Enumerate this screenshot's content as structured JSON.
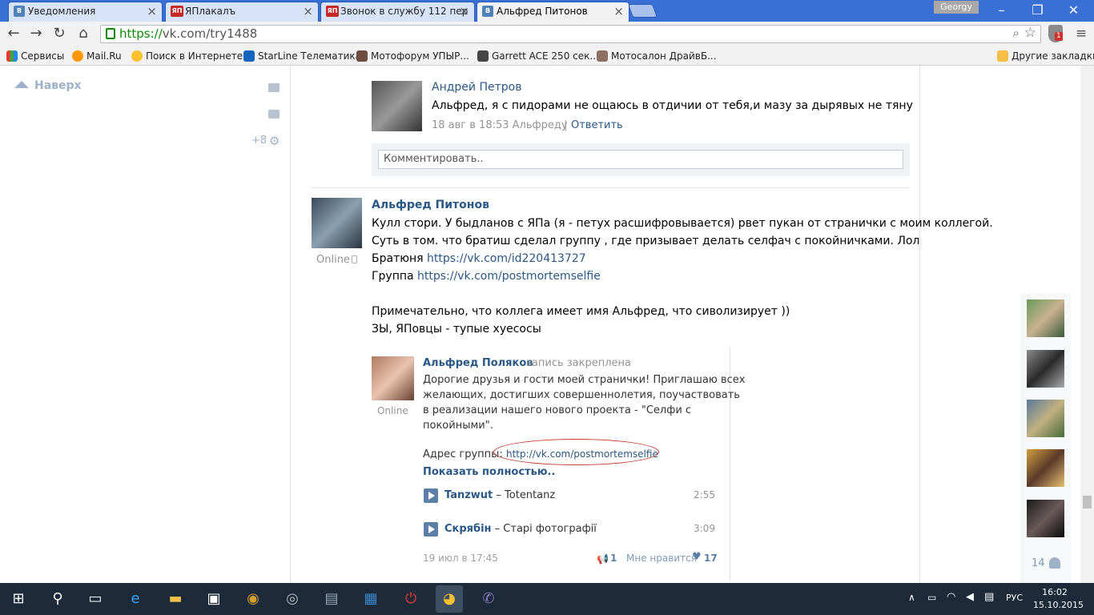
{
  "browser": {
    "tabs": [
      {
        "label": "Уведомления",
        "icon": "vk-favicon"
      },
      {
        "label": "ЯПлакалъ",
        "icon": "yap-favicon"
      },
      {
        "label": "Звонок в службу 112 пер",
        "icon": "yap-favicon"
      },
      {
        "label": "Альфред Питонов",
        "icon": "vk-favicon",
        "active": true
      }
    ],
    "profile_name": "Georgy",
    "url_scheme": "https://",
    "url_rest": "vk.com/try1488",
    "bookmarks": [
      "Сервисы",
      "Mail.Ru",
      "Поиск в Интернете",
      "StarLine Телематика",
      "Мотофорум УПЫР...",
      "Garrett ACE 250 сек...",
      "Мотосалон ДрайвБ..."
    ],
    "other_bookmarks": "Другие закладки",
    "extension_badge": "1"
  },
  "left": {
    "up_label": "Наверх",
    "counter": "+8"
  },
  "comment": {
    "author": "Андрей Петров",
    "text": "Альфред, я с пидорами не ощаюсь в отдичии от тебя,и мазу за дырявых не тяну",
    "date": "18 авг в 18:53 Альфреду",
    "separator": "|",
    "reply": "Ответить",
    "input_placeholder": "Комментировать.."
  },
  "post": {
    "author": "Альфред Питонов",
    "status": "Online",
    "line1": "Кулл стори. У быдланов с ЯПа (я - петух расшифровывается) рвет пукан от странички с моим коллегой.",
    "line2": "Суть в том. что братиш сделал группу , где призывает делать селфач с покойничками. Лол",
    "line3_label": "Братюня ",
    "line3_link": "https://vk.com/id220413727",
    "line4_label": "Группа ",
    "line4_link": "https://vk.com/postmortemselfie",
    "line5": "Примечательно, что коллега имеет имя Альфред, что сиволизирует ))",
    "line6": "ЗЫ, ЯПовцы - тупые хуесосы"
  },
  "repost": {
    "author": "Альфред Поляков",
    "pinned": "запись закреплена",
    "status": "Online",
    "text_1": "Дорогие друзья и гости моей странички! Приглашаю всех",
    "text_2": "желающих, достигших совершеннолетия, поучаствовать",
    "text_3": "в реализации нашего нового проекта - \"Селфи с",
    "text_4": "покойными\".",
    "address_label": "Адрес группы: ",
    "address_link": "http://vk.com/postmortemselfie",
    "show_more": "Показать полностью..",
    "tracks": [
      {
        "artist": "Tanzwut",
        "title": " – Totentanz",
        "duration": "2:55"
      },
      {
        "artist": "Скрябін",
        "title": " – Старі фотографії",
        "duration": "3:09"
      }
    ],
    "date": "19 июл в 17:45",
    "reposts": "1",
    "like_label": "Мне нравится",
    "likes": "17"
  },
  "sidebar": {
    "friends_count": "14"
  },
  "taskbar": {
    "lang": "РУС",
    "time": "16:02",
    "date": "15.10.2015"
  }
}
